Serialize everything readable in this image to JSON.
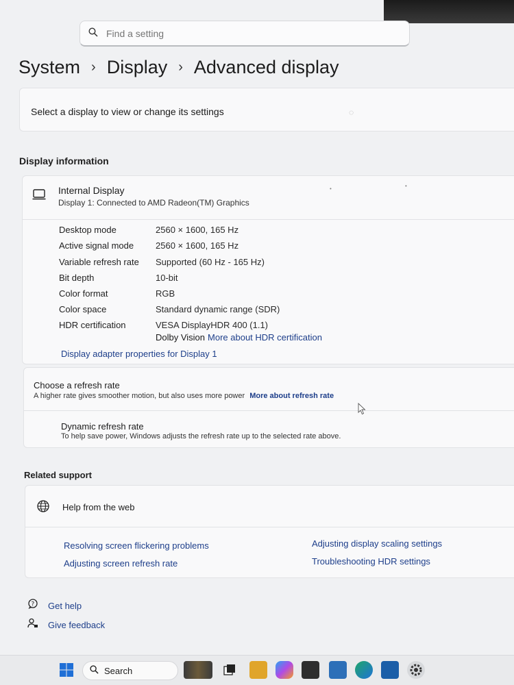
{
  "search": {
    "placeholder": "Find a setting"
  },
  "breadcrumb": [
    "System",
    "Display",
    "Advanced display"
  ],
  "select_display": {
    "text": "Select a display to view or change its settings"
  },
  "display_info": {
    "section_title": "Display information",
    "name": "Internal Display",
    "connection": "Display 1: Connected to AMD Radeon(TM) Graphics",
    "properties": [
      {
        "label": "Desktop mode",
        "value": "2560 × 1600, 165 Hz"
      },
      {
        "label": "Active signal mode",
        "value": "2560 × 1600, 165 Hz"
      },
      {
        "label": "Variable refresh rate",
        "value": "Supported (60 Hz - 165 Hz)"
      },
      {
        "label": "Bit depth",
        "value": "10-bit"
      },
      {
        "label": "Color format",
        "value": "RGB"
      },
      {
        "label": "Color space",
        "value": "Standard dynamic range (SDR)"
      },
      {
        "label": "HDR certification",
        "value": "VESA DisplayHDR 400 (1.1)"
      }
    ],
    "hdr_second_line": "Dolby Vision",
    "hdr_link": "More about HDR certification",
    "adapter_link": "Display adapter properties for Display 1"
  },
  "refresh": {
    "title": "Choose a refresh rate",
    "desc": "A higher rate gives smoother motion, but also uses more power",
    "link": "More about refresh rate",
    "dynamic_title": "Dynamic refresh rate",
    "dynamic_desc": "To help save power, Windows adjusts the refresh rate up to the selected rate above."
  },
  "support": {
    "section_title": "Related support",
    "help_web": "Help from the web",
    "links": [
      "Resolving screen flickering problems",
      "Adjusting display scaling settings",
      "Adjusting screen refresh rate",
      "Troubleshooting HDR settings"
    ]
  },
  "footer": {
    "get_help": "Get help",
    "give_feedback": "Give feedback"
  },
  "taskbar": {
    "search_label": "Search",
    "icons": [
      "windows-start-icon",
      "game-app-icon",
      "task-view-icon",
      "file-explorer-icon",
      "copilot-icon",
      "store-icon",
      "notepad-icon",
      "edge-icon",
      "pen-app-icon",
      "settings-icon"
    ]
  },
  "colors": {
    "link": "#1d3e8a",
    "background": "#f0f1f3",
    "card": "#f9f9fa"
  }
}
